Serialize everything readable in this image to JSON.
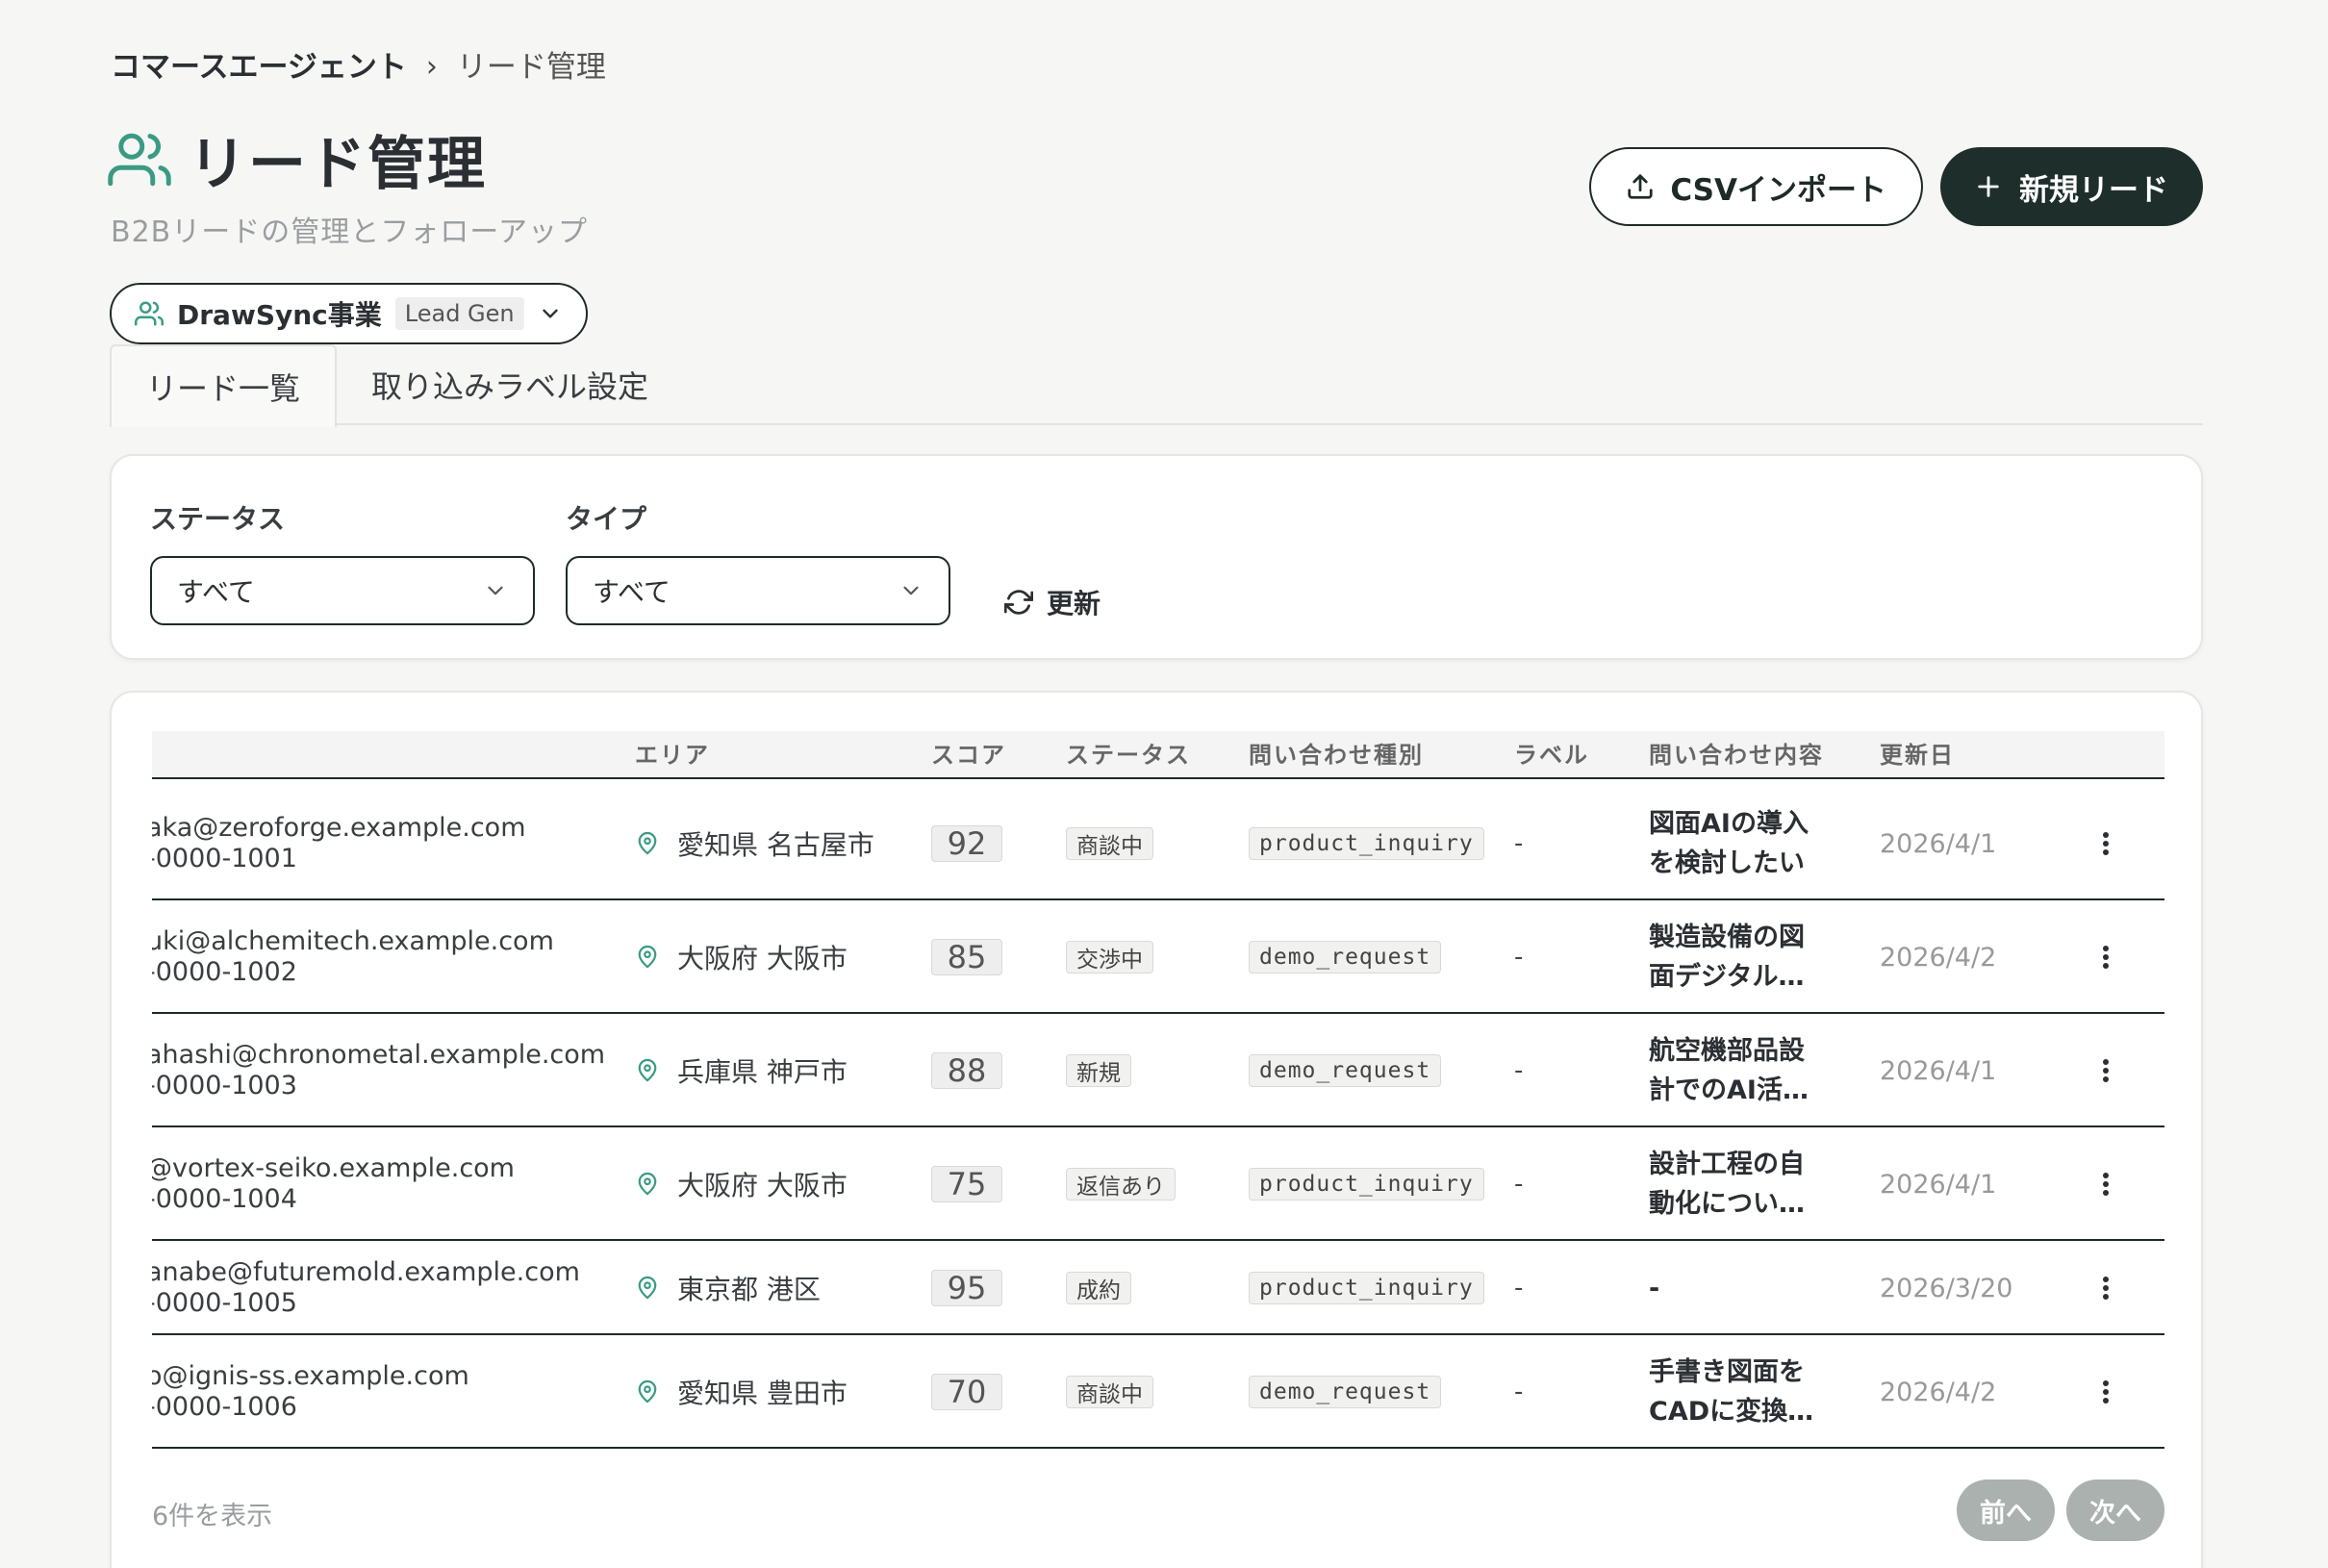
{
  "breadcrumb": {
    "root": "コマースエージェント",
    "separator": "›",
    "current": "リード管理"
  },
  "page": {
    "title": "リード管理",
    "subtitle": "B2Bリードの管理とフォローアップ"
  },
  "actions": {
    "csv_import": "CSVインポート",
    "new_lead": "新規リード"
  },
  "project": {
    "name": "DrawSync事業",
    "badge": "Lead Gen"
  },
  "tabs": [
    {
      "label": "リード一覧",
      "active": true
    },
    {
      "label": "取り込みラベル設定",
      "active": false
    }
  ],
  "filters": {
    "status": {
      "label": "ステータス",
      "value": "すべて"
    },
    "type": {
      "label": "タイプ",
      "value": "すべて"
    },
    "refresh_label": "更新"
  },
  "table": {
    "headers": {
      "area": "エリア",
      "score": "スコア",
      "status": "ステータス",
      "inquiry_type": "問い合わせ種別",
      "label": "ラベル",
      "content": "問い合わせ内容",
      "updated": "更新日"
    },
    "rows": [
      {
        "email": "aka@zeroforge.example.com",
        "phone": "-0000-1001",
        "area": "愛知県 名古屋市",
        "score": "92",
        "status": "商談中",
        "inquiry_type": "product_inquiry",
        "label": "-",
        "content1": "図面AIの導入",
        "content2": "を検討したい",
        "updated": "2026/4/1"
      },
      {
        "email": "uki@alchemitech.example.com",
        "phone": "-0000-1002",
        "area": "大阪府 大阪市",
        "score": "85",
        "status": "交渉中",
        "inquiry_type": "demo_request",
        "label": "-",
        "content1": "製造設備の図",
        "content2": "面デジタル…",
        "updated": "2026/4/2"
      },
      {
        "email": "ahashi@chronometal.example.com",
        "phone": "-0000-1003",
        "area": "兵庫県 神戸市",
        "score": "88",
        "status": "新規",
        "inquiry_type": "demo_request",
        "label": "-",
        "content1": "航空機部品設",
        "content2": "計でのAI活…",
        "updated": "2026/4/1"
      },
      {
        "email": "@vortex-seiko.example.com",
        "phone": "-0000-1004",
        "area": "大阪府 大阪市",
        "score": "75",
        "status": "返信あり",
        "inquiry_type": "product_inquiry",
        "label": "-",
        "content1": "設計工程の自",
        "content2": "動化につい…",
        "updated": "2026/4/1"
      },
      {
        "email": "anabe@futuremold.example.com",
        "phone": "-0000-1005",
        "area": "東京都 港区",
        "score": "95",
        "status": "成約",
        "inquiry_type": "product_inquiry",
        "label": "-",
        "content1": "-",
        "content2": "",
        "updated": "2026/3/20"
      },
      {
        "email": "o@ignis-ss.example.com",
        "phone": "-0000-1006",
        "area": "愛知県 豊田市",
        "score": "70",
        "status": "商談中",
        "inquiry_type": "demo_request",
        "label": "-",
        "content1": "手書き図面を",
        "content2": "CADに変換…",
        "updated": "2026/4/2"
      }
    ],
    "footer_count": "6件を表示",
    "prev_label": "前へ",
    "next_label": "次へ"
  },
  "colors": {
    "accent": "#3a9b82",
    "primary": "#1e2f2b",
    "pager": "#aab1ae"
  },
  "icons": {
    "title": "users-icon",
    "upload": "upload-icon",
    "plus": "plus-icon",
    "refresh": "refresh-icon",
    "location": "map-pin-icon",
    "more": "more-vertical-icon"
  }
}
